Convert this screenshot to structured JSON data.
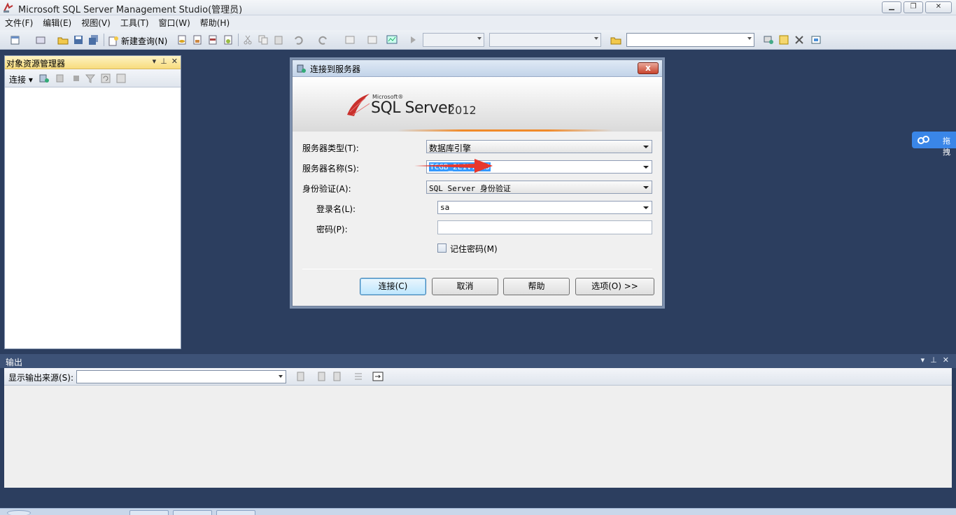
{
  "window": {
    "title": "Microsoft SQL Server Management Studio(管理员)"
  },
  "window_controls": {
    "minimize": "▁",
    "restore": "❐",
    "close": "✕"
  },
  "menu": [
    "文件(F)",
    "编辑(E)",
    "视图(V)",
    "工具(T)",
    "窗口(W)",
    "帮助(H)"
  ],
  "toolbar": {
    "new_query": "新建查询(N)"
  },
  "object_explorer": {
    "title": "对象资源管理器",
    "connect": "连接 ▾"
  },
  "output": {
    "title": "输出",
    "source_label": "显示输出来源(S):"
  },
  "side_widget": {
    "label": "拖拽"
  },
  "dialog": {
    "title": "连接到服务器",
    "close": "x",
    "logo": {
      "microsoft": "Microsoft®",
      "product": "SQL Server",
      "version": "2012"
    },
    "fields": {
      "server_type": {
        "label": "服务器类型(T):",
        "value": "数据库引擎"
      },
      "server_name": {
        "label": "服务器名称(S):",
        "value": "TCGB_2L1V7AH5"
      },
      "authentication": {
        "label": "身份验证(A):",
        "value": "SQL Server 身份验证"
      },
      "login": {
        "label": "登录名(L):",
        "value": "sa"
      },
      "password": {
        "label": "密码(P):",
        "value": ""
      },
      "remember": {
        "label": "记住密码(M)",
        "checked": false
      }
    },
    "buttons": {
      "connect": "连接(C)",
      "cancel": "取消",
      "help": "帮助",
      "options": "选项(O) >>"
    }
  },
  "colors": {
    "workspace": "#2c3e5f",
    "accent_orange": "#f08a2a",
    "highlight": "#3399ff",
    "annotation_red": "#e8372c"
  }
}
